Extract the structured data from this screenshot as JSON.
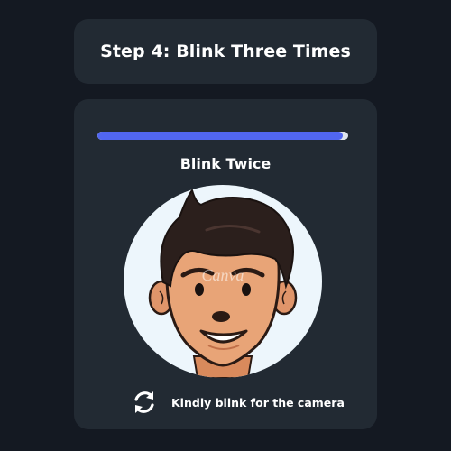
{
  "header": {
    "title": "Step 4: Blink Three Times"
  },
  "progress": {
    "fraction": 0.98
  },
  "instruction": {
    "label": "Blink Twice"
  },
  "avatar": {
    "watermark": "Canva"
  },
  "status": {
    "icon": "refresh-icon",
    "message": "Kindly blink for the camera"
  },
  "colors": {
    "background": "#141922",
    "card": "#222a33",
    "accent": "#5166f0",
    "track": "#dfe4ec",
    "avatar_bg": "#edf6fc"
  }
}
